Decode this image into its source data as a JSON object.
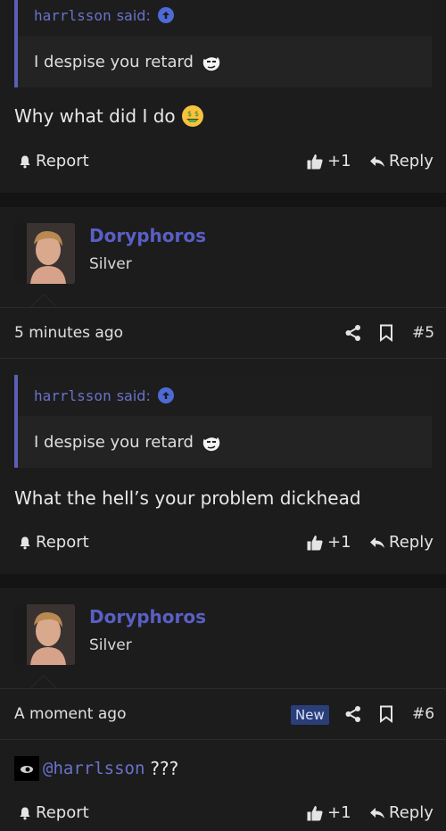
{
  "posts": [
    {
      "quote": {
        "author": "harrlsson",
        "said": "said:",
        "text": "I despise you retard"
      },
      "message": "Why what did I do",
      "actions": {
        "report": "Report",
        "like": "+1",
        "reply": "Reply"
      }
    },
    {
      "user": {
        "name": "Doryphoros",
        "rank": "Silver"
      },
      "meta": {
        "time": "5 minutes ago",
        "number": "#5"
      },
      "quote": {
        "author": "harrlsson",
        "said": "said:",
        "text": "I despise you retard"
      },
      "message": "What the hell’s your problem dickhead",
      "actions": {
        "report": "Report",
        "like": "+1",
        "reply": "Reply"
      }
    },
    {
      "user": {
        "name": "Doryphoros",
        "rank": "Silver"
      },
      "meta": {
        "time": "A moment ago",
        "badge": "New",
        "number": "#6"
      },
      "mention": "@harrlsson",
      "message": "???",
      "actions": {
        "report": "Report",
        "like": "+1",
        "reply": "Reply"
      }
    }
  ],
  "colors": {
    "accent": "#5a5fc4",
    "background": "#1c1c1c",
    "badge": "#2a3e78"
  }
}
